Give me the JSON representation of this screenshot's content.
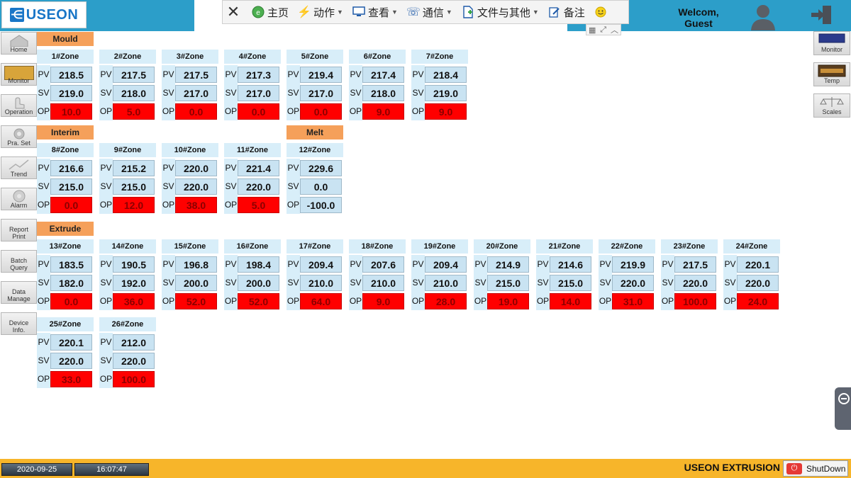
{
  "header": {
    "logo_text": "USEON",
    "welcome_line1": "Welcom,",
    "welcome_line2": "Guest"
  },
  "toolbar": {
    "items": [
      {
        "label": "主页",
        "icon": "home-icon"
      },
      {
        "label": "动作",
        "icon": "lightning-icon"
      },
      {
        "label": "查看",
        "icon": "monitor-icon"
      },
      {
        "label": "通信",
        "icon": "phone-icon"
      },
      {
        "label": "文件与其他",
        "icon": "file-icon"
      },
      {
        "label": "备注",
        "icon": "note-icon"
      }
    ]
  },
  "left_nav": [
    {
      "label": "Home"
    },
    {
      "label": "Monitor",
      "active": true
    },
    {
      "label": "Operation"
    },
    {
      "label": "Pra. Set"
    },
    {
      "label": "Trend"
    },
    {
      "label": "Alarm"
    },
    {
      "label": "Report Print"
    },
    {
      "label": "Batch Query"
    },
    {
      "label": "Data Manage"
    },
    {
      "label": "Device Info."
    }
  ],
  "right_nav": [
    {
      "label": "Monitor"
    },
    {
      "label": "Temp"
    },
    {
      "label": "Scales"
    }
  ],
  "sections": {
    "mould": "Mould",
    "interim": "Interim",
    "melt": "Melt",
    "extrude": "Extrude"
  },
  "zone_labels": {
    "pv": "PV",
    "sv": "SV",
    "op": "OP"
  },
  "zones": [
    {
      "name": "1#Zone",
      "pv": "218.5",
      "sv": "219.0",
      "op": "10.0",
      "op_state": "red"
    },
    {
      "name": "2#Zone",
      "pv": "217.5",
      "sv": "218.0",
      "op": "5.0",
      "op_state": "red"
    },
    {
      "name": "3#Zone",
      "pv": "217.5",
      "sv": "217.0",
      "op": "0.0",
      "op_state": "red"
    },
    {
      "name": "4#Zone",
      "pv": "217.3",
      "sv": "217.0",
      "op": "0.0",
      "op_state": "red"
    },
    {
      "name": "5#Zone",
      "pv": "219.4",
      "sv": "217.0",
      "op": "0.0",
      "op_state": "red"
    },
    {
      "name": "6#Zone",
      "pv": "217.4",
      "sv": "218.0",
      "op": "9.0",
      "op_state": "red"
    },
    {
      "name": "7#Zone",
      "pv": "218.4",
      "sv": "219.0",
      "op": "9.0",
      "op_state": "red"
    },
    {
      "name": "8#Zone",
      "pv": "216.6",
      "sv": "215.0",
      "op": "0.0",
      "op_state": "red"
    },
    {
      "name": "9#Zone",
      "pv": "215.2",
      "sv": "215.0",
      "op": "12.0",
      "op_state": "red"
    },
    {
      "name": "10#Zone",
      "pv": "220.0",
      "sv": "220.0",
      "op": "38.0",
      "op_state": "red"
    },
    {
      "name": "11#Zone",
      "pv": "221.4",
      "sv": "220.0",
      "op": "5.0",
      "op_state": "red"
    },
    {
      "name": "12#Zone",
      "pv": "229.6",
      "sv": "0.0",
      "op": "-100.0",
      "op_state": "blue"
    },
    {
      "name": "13#Zone",
      "pv": "183.5",
      "sv": "182.0",
      "op": "0.0",
      "op_state": "red"
    },
    {
      "name": "14#Zone",
      "pv": "190.5",
      "sv": "192.0",
      "op": "36.0",
      "op_state": "red"
    },
    {
      "name": "15#Zone",
      "pv": "196.8",
      "sv": "200.0",
      "op": "52.0",
      "op_state": "red"
    },
    {
      "name": "16#Zone",
      "pv": "198.4",
      "sv": "200.0",
      "op": "52.0",
      "op_state": "red"
    },
    {
      "name": "17#Zone",
      "pv": "209.4",
      "sv": "210.0",
      "op": "64.0",
      "op_state": "red"
    },
    {
      "name": "18#Zone",
      "pv": "207.6",
      "sv": "210.0",
      "op": "9.0",
      "op_state": "red"
    },
    {
      "name": "19#Zone",
      "pv": "209.4",
      "sv": "210.0",
      "op": "28.0",
      "op_state": "red"
    },
    {
      "name": "20#Zone",
      "pv": "214.9",
      "sv": "215.0",
      "op": "19.0",
      "op_state": "red"
    },
    {
      "name": "21#Zone",
      "pv": "214.6",
      "sv": "215.0",
      "op": "14.0",
      "op_state": "red"
    },
    {
      "name": "22#Zone",
      "pv": "219.9",
      "sv": "220.0",
      "op": "31.0",
      "op_state": "red"
    },
    {
      "name": "23#Zone",
      "pv": "217.5",
      "sv": "220.0",
      "op": "100.0",
      "op_state": "red"
    },
    {
      "name": "24#Zone",
      "pv": "220.1",
      "sv": "220.0",
      "op": "24.0",
      "op_state": "red"
    },
    {
      "name": "25#Zone",
      "pv": "220.1",
      "sv": "220.0",
      "op": "33.0",
      "op_state": "red"
    },
    {
      "name": "26#Zone",
      "pv": "212.0",
      "sv": "220.0",
      "op": "100.0",
      "op_state": "red"
    }
  ],
  "footer": {
    "date": "2020-09-25",
    "time": "16:07:47",
    "brand": "USEON EXTRUSION",
    "shutdown_label": "ShutDown"
  },
  "colors": {
    "header_bg": "#2c9ec9",
    "footer_bg": "#f7b52a",
    "section_bg": "#f5a05a",
    "zone_title_bg": "#d8eef9",
    "value_bg": "#c9e3f2",
    "op_alarm": "#ff0000"
  }
}
